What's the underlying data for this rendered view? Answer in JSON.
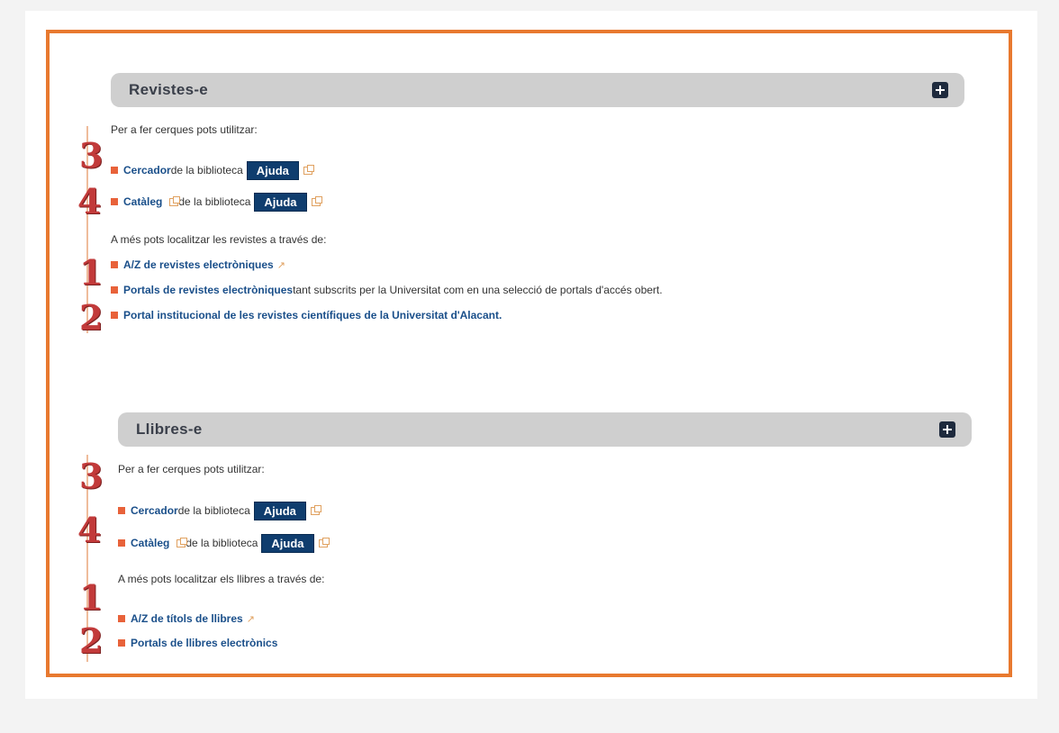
{
  "revistes": {
    "title": "Revistes-e",
    "intro": "Per a fer cerques pots utilitzar:",
    "cercador_link": "Cercador",
    "cercador_text": " de la biblioteca",
    "cataleg_link": "Catàleg",
    "cataleg_text": " de la biblioteca",
    "ajuda": "Ajuda",
    "more": "A més pots localitzar les revistes a través de:",
    "az_link": "A/Z de revistes electròniques",
    "portals_link": "Portals de revistes electròniques",
    "portals_text": " tant subscrits per la Universitat com en una selecció de portals d'accés obert.",
    "portal_inst_link": "Portal institucional de les revistes científiques de la Universitat d'Alacant."
  },
  "llibres": {
    "title": "Llibres-e",
    "intro": "Per a fer cerques pots utilitzar:",
    "cercador_link": "Cercador",
    "cercador_text": " de la biblioteca",
    "cataleg_link": "Catàleg",
    "cataleg_text": " de la biblioteca",
    "ajuda": "Ajuda",
    "more": "A més pots localitzar els llibres a través de:",
    "az_link": "A/Z de títols de llibres",
    "portals_link": "Portals de llibres electrònics"
  },
  "annotations": [
    "3",
    "4",
    "1",
    "2"
  ],
  "icons": {
    "expand": "plus-square-icon",
    "external": "external-link-icon",
    "bullet": "square-bullet-icon"
  },
  "colors": {
    "frame": "#e8792f",
    "bar": "#cfcfcf",
    "link": "#1a4f8a",
    "button": "#0f3d6e",
    "annotation": "#c23a3a"
  }
}
